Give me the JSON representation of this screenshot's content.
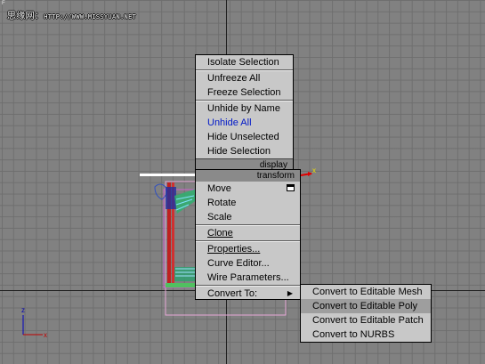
{
  "viewport": {
    "corner_label": "F",
    "watermark_text": "思缘网：",
    "watermark_url": "HTTP://WWW.MISSYUAN.NET",
    "axis_labels": {
      "z": "z",
      "x": "x"
    }
  },
  "quad_menu": {
    "display_items": [
      "Isolate Selection",
      "Unfreeze All",
      "Freeze Selection",
      "Unhide by Name",
      "Unhide All",
      "Hide Unselected",
      "Hide Selection"
    ],
    "display_label": "display",
    "transform_label": "transform",
    "transform_items": [
      "Move",
      "Rotate",
      "Scale",
      "Clone",
      "Properties...",
      "Curve Editor...",
      "Wire Parameters...",
      "Convert To:"
    ]
  },
  "convert_submenu": {
    "items": [
      "Convert to Editable Mesh",
      "Convert to Editable Poly",
      "Convert to Editable Patch",
      "Convert to NURBS"
    ],
    "highlighted_index": 1
  },
  "colors": {
    "viewport_bg": "#818181",
    "menu_bg": "#c8c8c8",
    "band_bg": "#8a8a8a",
    "unhide_all_text": "#0018c8",
    "submenu_highlight": "#9e9e9e"
  }
}
